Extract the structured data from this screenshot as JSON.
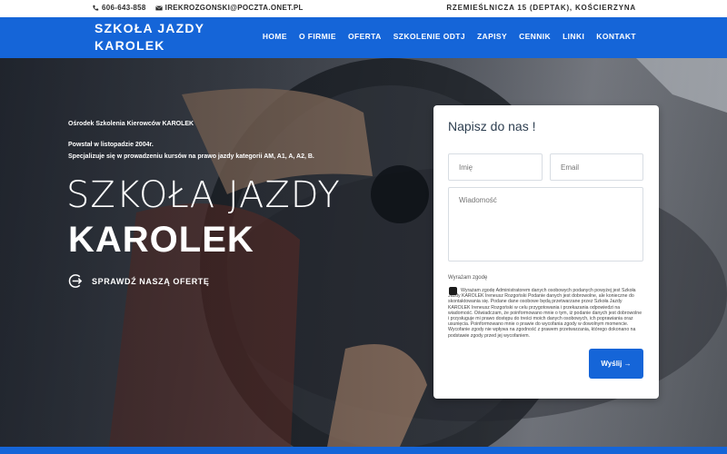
{
  "topbar": {
    "phone": "606-643-858",
    "email": "IREKROZGONSKI@POCZTA.ONET.PL",
    "address": "RZEMIEŚLNICZA 15 (DEPTAK), KOŚCIERZYNA"
  },
  "header": {
    "logo": "SZKOŁA JAZDY KAROLEK",
    "nav": [
      "HOME",
      "O FIRMIE",
      "OFERTA",
      "SZKOLENIE ODTJ",
      "ZAPISY",
      "CENNIK",
      "LINKI",
      "KONTAKT"
    ]
  },
  "hero": {
    "line1": "Ośrodek Szkolenia Kierowców KAROLEK",
    "line2": "Powstał w listopadzie 2004r.",
    "line3": "Specjalizuje się w prowadzeniu kursów na prawo jazdy kategorii AM, A1, A, A2, B.",
    "title_light": "SZKOŁA JAZDY",
    "title_bold": "KAROLEK",
    "cta": "SPRAWDŹ NASZĄ OFERTĘ"
  },
  "form": {
    "title": "Napisz do nas !",
    "name_placeholder": "Imię",
    "email_placeholder": "Email",
    "message_placeholder": "Wiadomość",
    "consent_label": "Wyrażam zgodę",
    "consent_text": "Wyrażam zgodę Administratorem danych osobowych podanych powyżej jest Szkoła Jazdy KAROLEK Ireneusz Rozgoński Podanie danych jest dobrowolne, ale konieczne do skontaktowania się. Podane dane osobowe będą przetwarzane przez Szkoła Jazdy KAROLEK Ireneusz Rozgoński w celu przygotowania i przekazania odpowiedzi na wiadomość. Oświadczam, że poinformowano mnie o tym, iż podanie danych jest dobrowolne i przysługuje mi prawo dostępu do treści moich danych osobowych, ich poprawiania oraz usunięcia. Poinformowano mnie o prawie do wycofania zgody w dowolnym momencie. Wycofanie zgody nie wpływa na zgodność z prawem przetwarzania, którego dokonano na podstawie zgody przed jej wycofaniem.",
    "submit": "Wyślij →"
  },
  "colors": {
    "accent": "#1565d8"
  },
  "icons": {
    "phone": "phone-icon",
    "email": "envelope-icon",
    "cta": "arrow-circle-icon"
  }
}
